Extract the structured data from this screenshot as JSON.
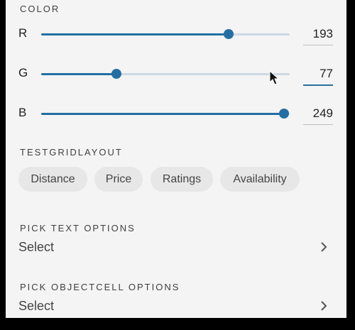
{
  "color": {
    "title": "COLOR",
    "sliders": [
      {
        "label": "R",
        "value": "193",
        "fraction": 0.755
      },
      {
        "label": "G",
        "value": "77",
        "fraction": 0.302
      },
      {
        "label": "B",
        "value": "249",
        "fraction": 0.977
      }
    ],
    "accent": "#236fa4"
  },
  "grid": {
    "title": "TESTGRIDLAYOUT",
    "chips": [
      "Distance",
      "Price",
      "Ratings",
      "Availability"
    ]
  },
  "pick_text": {
    "title": "PICK TEXT OPTIONS",
    "value": "Select"
  },
  "pick_objectcell": {
    "title": "PICK OBJECTCELL OPTIONS",
    "value": "Select"
  }
}
